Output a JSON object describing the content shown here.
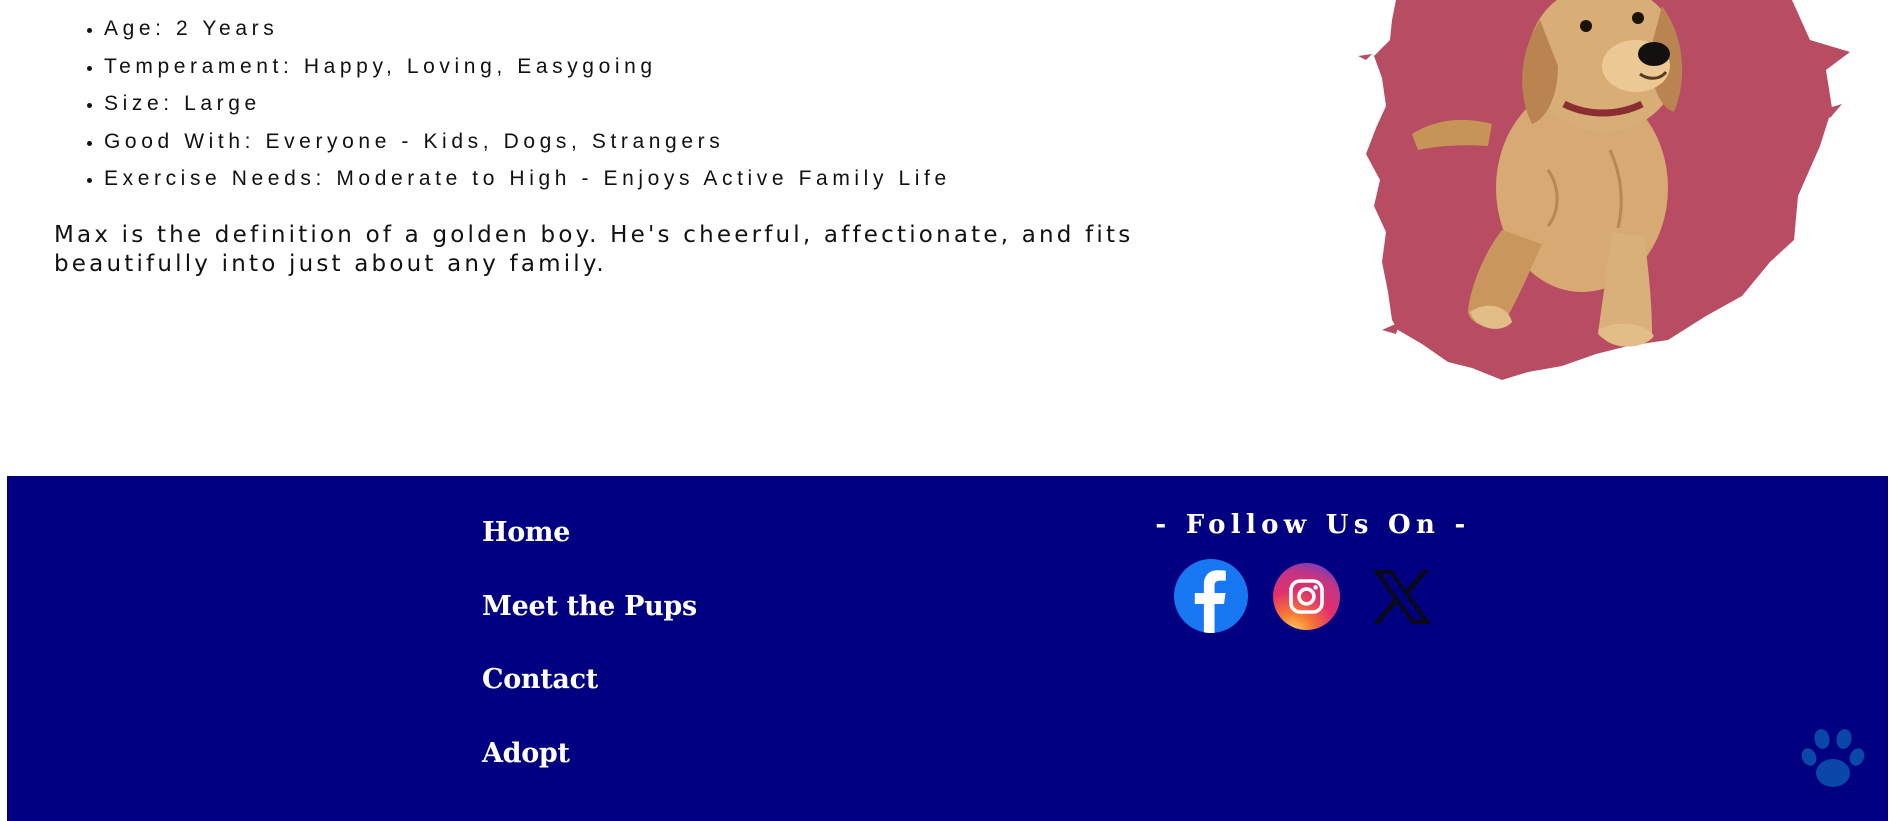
{
  "pup": {
    "traits": [
      "Age: 2 Years",
      "Temperament: Happy, Loving, Easygoing",
      "Size: Large",
      "Good With: Everyone - Kids, Dogs, Strangers",
      "Exercise Needs: Moderate to High - Enjoys Active Family Life"
    ],
    "summary": "Max is the definition of a golden boy. He's cheerful, affectionate, and fits beautifully into just about any family.",
    "photo_icon": "golden-retriever-puppy-on-paint-splash"
  },
  "footer": {
    "nav": {
      "home": "Home",
      "pups": "Meet the Pups",
      "contact": "Contact",
      "adopt": "Adopt"
    },
    "follow_label": "- Follow Us On -",
    "social": [
      {
        "name": "Facebook",
        "icon": "facebook-icon"
      },
      {
        "name": "Instagram",
        "icon": "instagram-icon"
      },
      {
        "name": "X",
        "icon": "x-icon"
      }
    ],
    "paw_icon": "paw-icon"
  },
  "colors": {
    "footer_bg": "#000080",
    "footer_text": "#ffffff",
    "splash": "#b74c63",
    "facebook": "#1877f2",
    "paw": "#0a47a8",
    "body_text": "#111111"
  }
}
